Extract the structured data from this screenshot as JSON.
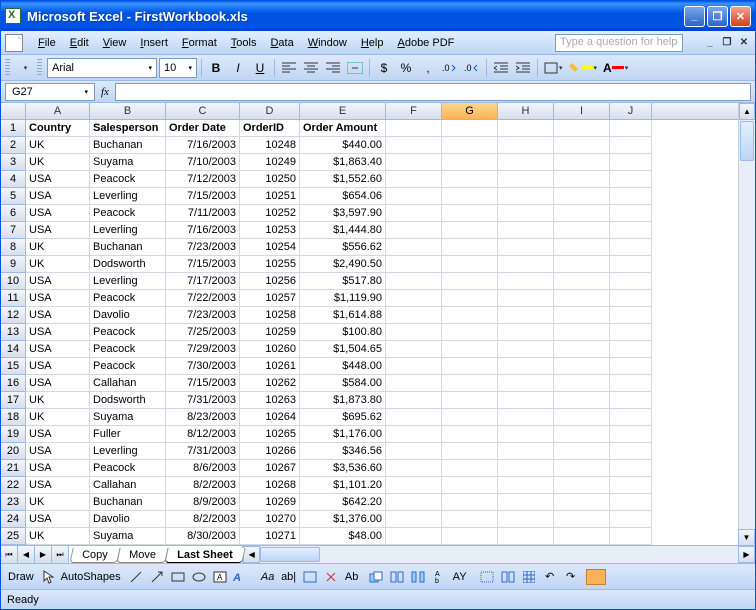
{
  "app": {
    "title": "Microsoft Excel - FirstWorkbook.xls"
  },
  "menu": {
    "items": [
      "File",
      "Edit",
      "View",
      "Insert",
      "Format",
      "Tools",
      "Data",
      "Window",
      "Help",
      "Adobe PDF"
    ],
    "help_placeholder": "Type a question for help"
  },
  "toolbar": {
    "font_name": "Arial",
    "font_size": "10"
  },
  "namebox": {
    "ref": "G27"
  },
  "columns": {
    "labels": [
      "A",
      "B",
      "C",
      "D",
      "E",
      "F",
      "G",
      "H",
      "I",
      "J"
    ],
    "widths": [
      64,
      76,
      74,
      60,
      86,
      56,
      56,
      56,
      56,
      42
    ],
    "selected": "G"
  },
  "headers": [
    "Country",
    "Salesperson",
    "Order Date",
    "OrderID",
    "Order Amount"
  ],
  "rows": [
    {
      "n": 1
    },
    {
      "n": 2,
      "c": [
        "UK",
        "Buchanan",
        "7/16/2003",
        "10248",
        "$440.00"
      ]
    },
    {
      "n": 3,
      "c": [
        "UK",
        "Suyama",
        "7/10/2003",
        "10249",
        "$1,863.40"
      ]
    },
    {
      "n": 4,
      "c": [
        "USA",
        "Peacock",
        "7/12/2003",
        "10250",
        "$1,552.60"
      ]
    },
    {
      "n": 5,
      "c": [
        "USA",
        "Leverling",
        "7/15/2003",
        "10251",
        "$654.06"
      ]
    },
    {
      "n": 6,
      "c": [
        "USA",
        "Peacock",
        "7/11/2003",
        "10252",
        "$3,597.90"
      ]
    },
    {
      "n": 7,
      "c": [
        "USA",
        "Leverling",
        "7/16/2003",
        "10253",
        "$1,444.80"
      ]
    },
    {
      "n": 8,
      "c": [
        "UK",
        "Buchanan",
        "7/23/2003",
        "10254",
        "$556.62"
      ]
    },
    {
      "n": 9,
      "c": [
        "UK",
        "Dodsworth",
        "7/15/2003",
        "10255",
        "$2,490.50"
      ]
    },
    {
      "n": 10,
      "c": [
        "USA",
        "Leverling",
        "7/17/2003",
        "10256",
        "$517.80"
      ]
    },
    {
      "n": 11,
      "c": [
        "USA",
        "Peacock",
        "7/22/2003",
        "10257",
        "$1,119.90"
      ]
    },
    {
      "n": 12,
      "c": [
        "USA",
        "Davolio",
        "7/23/2003",
        "10258",
        "$1,614.88"
      ]
    },
    {
      "n": 13,
      "c": [
        "USA",
        "Peacock",
        "7/25/2003",
        "10259",
        "$100.80"
      ]
    },
    {
      "n": 14,
      "c": [
        "USA",
        "Peacock",
        "7/29/2003",
        "10260",
        "$1,504.65"
      ]
    },
    {
      "n": 15,
      "c": [
        "USA",
        "Peacock",
        "7/30/2003",
        "10261",
        "$448.00"
      ]
    },
    {
      "n": 16,
      "c": [
        "USA",
        "Callahan",
        "7/15/2003",
        "10262",
        "$584.00"
      ]
    },
    {
      "n": 17,
      "c": [
        "UK",
        "Dodsworth",
        "7/31/2003",
        "10263",
        "$1,873.80"
      ]
    },
    {
      "n": 18,
      "c": [
        "UK",
        "Suyama",
        "8/23/2003",
        "10264",
        "$695.62"
      ]
    },
    {
      "n": 19,
      "c": [
        "USA",
        "Fuller",
        "8/12/2003",
        "10265",
        "$1,176.00"
      ]
    },
    {
      "n": 20,
      "c": [
        "USA",
        "Leverling",
        "7/31/2003",
        "10266",
        "$346.56"
      ]
    },
    {
      "n": 21,
      "c": [
        "USA",
        "Peacock",
        "8/6/2003",
        "10267",
        "$3,536.60"
      ]
    },
    {
      "n": 22,
      "c": [
        "USA",
        "Callahan",
        "8/2/2003",
        "10268",
        "$1,101.20"
      ]
    },
    {
      "n": 23,
      "c": [
        "UK",
        "Buchanan",
        "8/9/2003",
        "10269",
        "$642.20"
      ]
    },
    {
      "n": 24,
      "c": [
        "USA",
        "Davolio",
        "8/2/2003",
        "10270",
        "$1,376.00"
      ]
    },
    {
      "n": 25,
      "c": [
        "UK",
        "Suyama",
        "8/30/2003",
        "10271",
        "$48.00"
      ]
    }
  ],
  "tabs": {
    "items": [
      "Copy",
      "Move",
      "Last Sheet"
    ],
    "active": "Last Sheet"
  },
  "drawbar": {
    "draw": "Draw",
    "autoshapes": "AutoShapes"
  },
  "status": {
    "text": "Ready"
  }
}
